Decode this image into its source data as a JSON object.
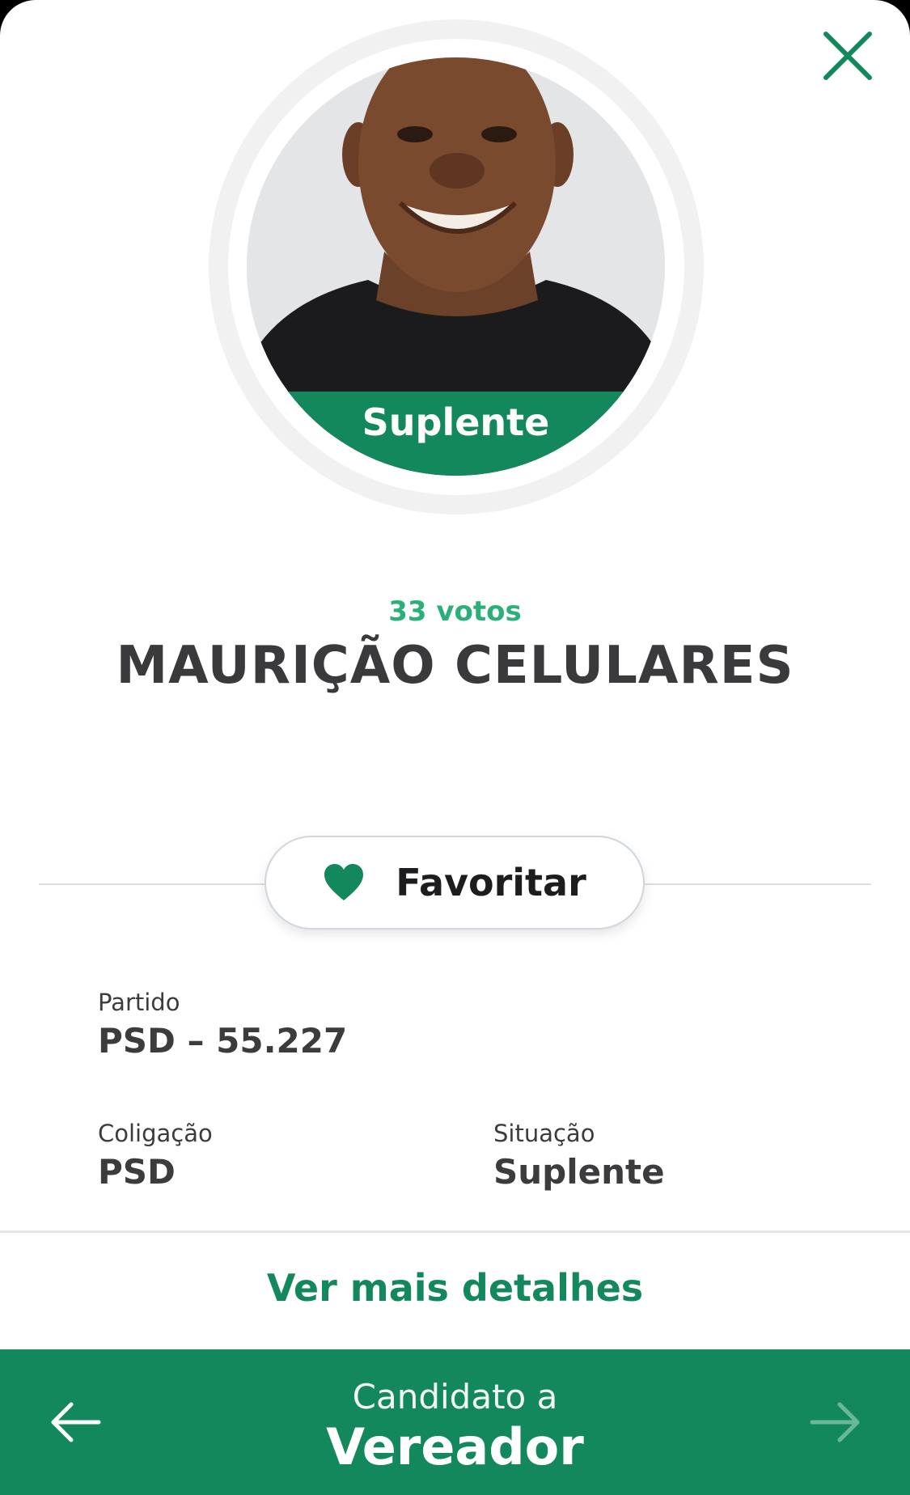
{
  "colors": {
    "brand_green": "#14885d",
    "votes_green": "#2bb079",
    "text_dark": "#3a3a3c",
    "heart": "#14885d",
    "next_arrow_disabled": "#6bb898"
  },
  "header": {
    "close_icon": "close-x-icon"
  },
  "profile": {
    "status_badge": "Suplente",
    "votes": "33 votos",
    "name": "MAURIÇÃO CELULARES"
  },
  "favorite": {
    "icon": "heart-icon",
    "label": "Favoritar"
  },
  "info": {
    "party_label": "Partido",
    "party_value": "PSD – 55.227",
    "coalition_label": "Coligação",
    "coalition_value": "PSD",
    "status_label": "Situação",
    "status_value": "Suplente"
  },
  "more_details": "Ver mais detalhes",
  "footer": {
    "subtitle": "Candidato a",
    "title": "Vereador",
    "prev_icon": "arrow-left-icon",
    "next_icon": "arrow-right-icon"
  }
}
